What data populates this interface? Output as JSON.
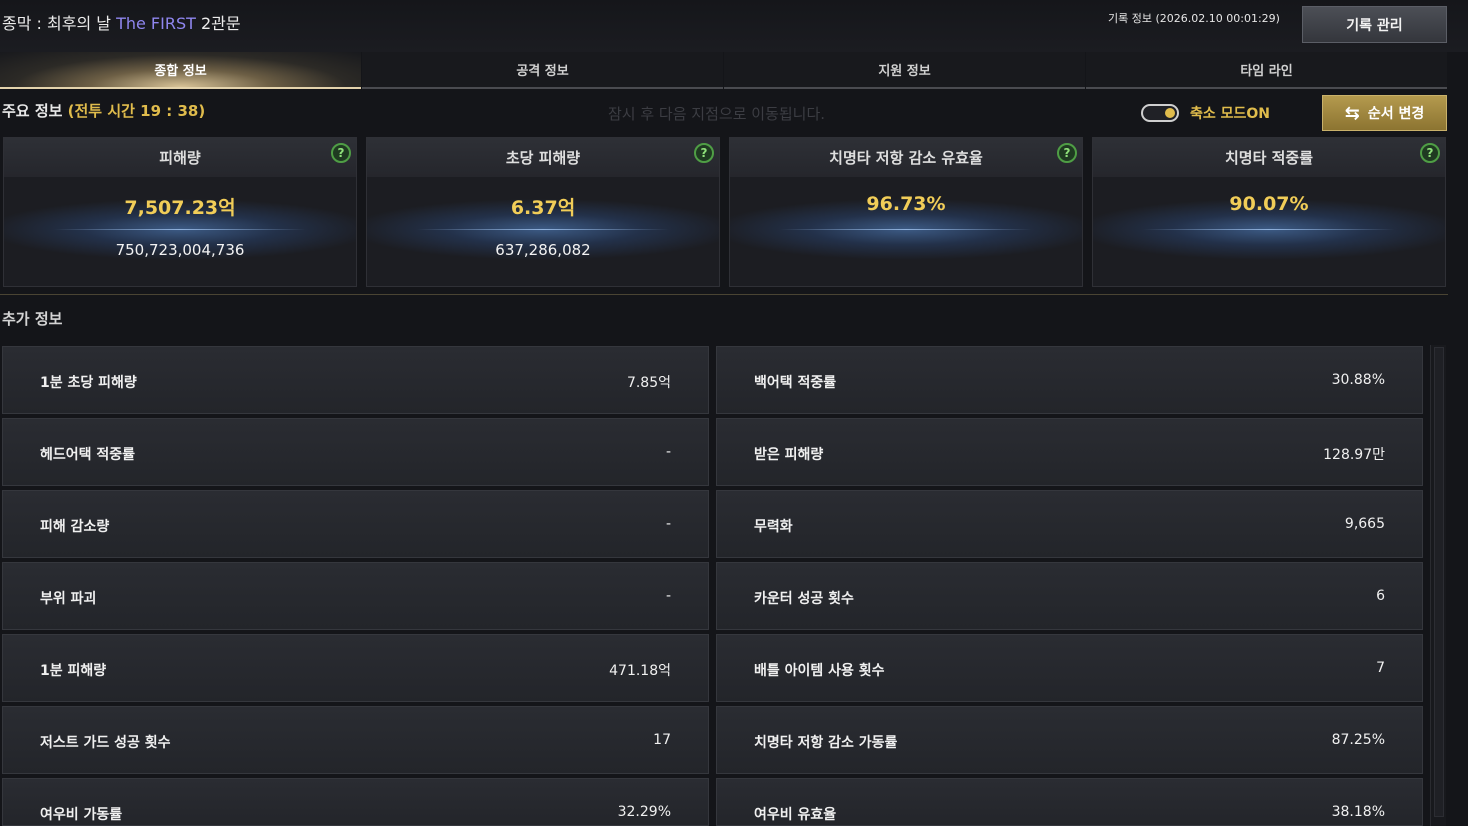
{
  "header": {
    "title_prefix": "종막 : 최후의 날 ",
    "title_highlight": "The FIRST",
    "title_suffix": " 2관문",
    "record_info": "기록 정보 (2026.02.10 00:01:29)",
    "manage_button": "기록 관리"
  },
  "tabs": [
    {
      "label": "종합 정보",
      "active": true
    },
    {
      "label": "공격 정보",
      "active": false
    },
    {
      "label": "지원 정보",
      "active": false
    },
    {
      "label": "타임 라인",
      "active": false
    }
  ],
  "summary": {
    "label": "주요 정보 ",
    "battle_time": "(전투 시간 19 : 38)",
    "notice": "잠시 후 다음 지점으로 이동됩니다.",
    "toggle_label": "축소 모드ON",
    "toggle_on": true,
    "order_button": "순서 변경"
  },
  "cards": [
    {
      "title": "피해량",
      "main": "7,507.23억",
      "sub": "750,723,004,736",
      "help": "?"
    },
    {
      "title": "초당 피해량",
      "main": "6.37억",
      "sub": "637,286,082",
      "help": "?"
    },
    {
      "title": "치명타 저항 감소 유효율",
      "main": "96.73%",
      "sub": "",
      "help": "?"
    },
    {
      "title": "치명타 적중률",
      "main": "90.07%",
      "sub": "",
      "help": "?"
    }
  ],
  "extra": {
    "title": "추가 정보",
    "left": [
      {
        "label": "1분 초당 피해량",
        "value": "7.85억"
      },
      {
        "label": "헤드어택 적중률",
        "value": "-"
      },
      {
        "label": "피해 감소량",
        "value": "-"
      },
      {
        "label": "부위 파괴",
        "value": "-"
      },
      {
        "label": "1분 피해량",
        "value": "471.18억"
      },
      {
        "label": "저스트 가드 성공 횟수",
        "value": "17"
      },
      {
        "label": "여우비 가동률",
        "value": "32.29%"
      }
    ],
    "right": [
      {
        "label": "백어택 적중률",
        "value": "30.88%"
      },
      {
        "label": "받은 피해량",
        "value": "128.97만"
      },
      {
        "label": "무력화",
        "value": "9,665"
      },
      {
        "label": "카운터 성공 횟수",
        "value": "6"
      },
      {
        "label": "배틀 아이템 사용 횟수",
        "value": "7"
      },
      {
        "label": "치명타 저항 감소 가동률",
        "value": "87.25%"
      },
      {
        "label": "여우비 유효율",
        "value": "38.18%"
      }
    ]
  },
  "colors": {
    "accent_gold": "#e0bc4c",
    "title_highlight": "#8f86ef",
    "background": "#141519"
  }
}
